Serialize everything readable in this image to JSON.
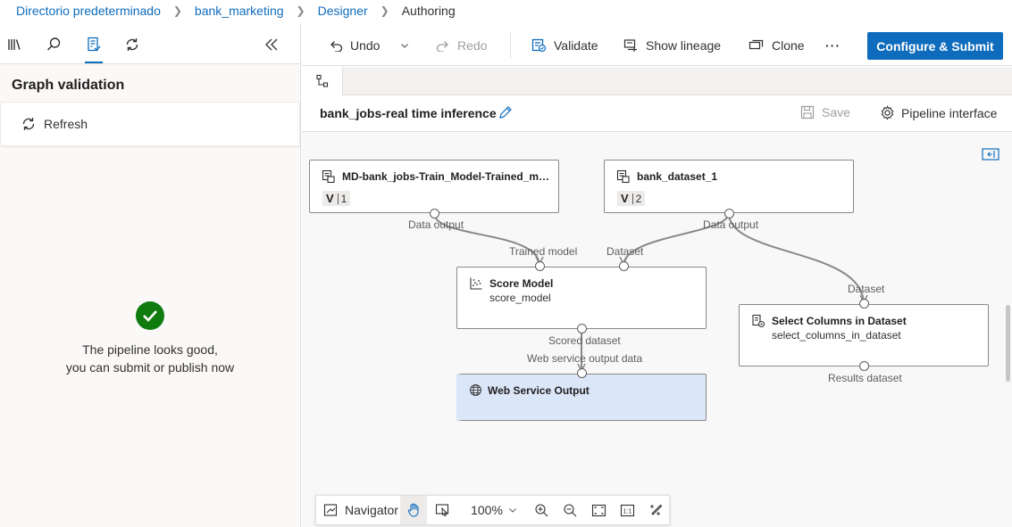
{
  "breadcrumb": {
    "items": [
      "Directorio predeterminado",
      "bank_marketing",
      "Designer"
    ],
    "current": "Authoring"
  },
  "left_panel": {
    "title": "Graph validation",
    "refresh_label": "Refresh",
    "status_line1": "The pipeline looks good,",
    "status_line2": "you can submit or publish now",
    "tool_icons": [
      "library-icon",
      "search-icon",
      "validation-icon",
      "refresh-icon",
      "collapse-left-icon"
    ]
  },
  "toolbar": {
    "undo_label": "Undo",
    "redo_label": "Redo",
    "validate_label": "Validate",
    "show_lineage_label": "Show lineage",
    "clone_label": "Clone",
    "more_label": "···",
    "submit_label": "Configure & Submit"
  },
  "title_bar": {
    "pipeline_name": "bank_jobs-real time inference",
    "save_label": "Save",
    "interface_label": "Pipeline interface"
  },
  "nodes": {
    "trained_model": {
      "title": "MD-bank_jobs-Train_Model-Trained_mo...",
      "version": "1",
      "output_label": "Data output"
    },
    "dataset": {
      "title": "bank_dataset_1",
      "version": "2",
      "output_label": "Data output"
    },
    "score_model": {
      "title": "Score Model",
      "subtitle": "score_model",
      "input1_label": "Trained model",
      "input2_label": "Dataset",
      "output_label": "Scored dataset"
    },
    "select_columns": {
      "title": "Select Columns in Dataset",
      "subtitle": "select_columns_in_dataset",
      "input_label": "Dataset",
      "output_label": "Results dataset"
    },
    "web_service_output": {
      "title": "Web Service Output",
      "input_label": "Web service output data"
    }
  },
  "navigator": {
    "navigator_label": "Navigator",
    "zoom_level": "100%"
  },
  "colors": {
    "accent": "#0f6cbd",
    "success": "#107c10",
    "selected_node": "#dbe6f8"
  }
}
